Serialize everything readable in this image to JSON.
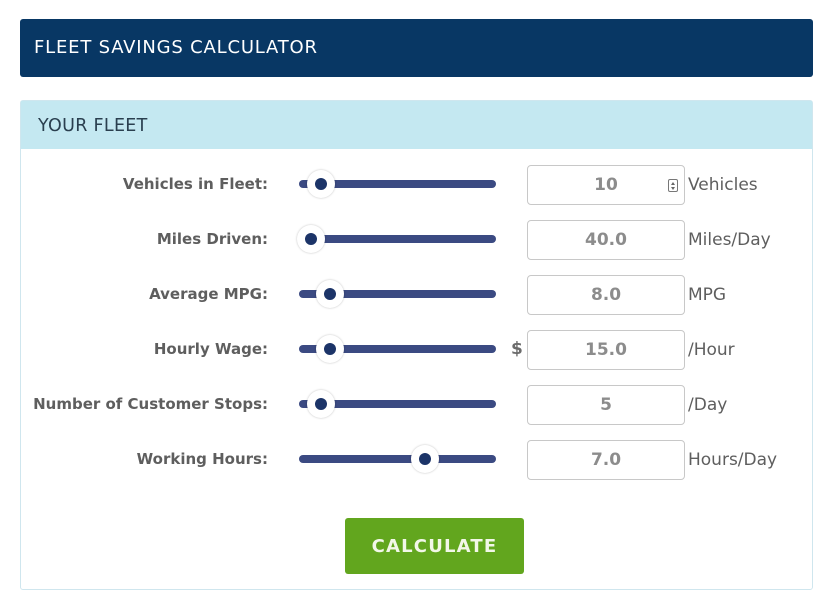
{
  "header": {
    "title": "FLEET SAVINGS CALCULATOR"
  },
  "panel": {
    "title": "YOUR FLEET"
  },
  "accent_colors": {
    "header_bg": "#083764",
    "panel_head_bg": "#c4e8f1",
    "slider_track": "#3b4a82",
    "button_bg": "#62a61e"
  },
  "rows": [
    {
      "label": "Vehicles in Fleet:",
      "value": "10",
      "unit": "Vehicles",
      "prefix": "",
      "slider_fraction": 0.06,
      "has_spinner": true
    },
    {
      "label": "Miles Driven:",
      "value": "40.0",
      "unit": "Miles/Day",
      "prefix": "",
      "slider_fraction": 0.0,
      "has_spinner": false
    },
    {
      "label": "Average MPG:",
      "value": "8.0",
      "unit": "MPG",
      "prefix": "",
      "slider_fraction": 0.11,
      "has_spinner": false
    },
    {
      "label": "Hourly Wage:",
      "value": "15.0",
      "unit": "/Hour",
      "prefix": "$",
      "slider_fraction": 0.11,
      "has_spinner": false
    },
    {
      "label": "Number of Customer Stops:",
      "value": "5",
      "unit": "/Day",
      "prefix": "",
      "slider_fraction": 0.06,
      "has_spinner": false
    },
    {
      "label": "Working Hours:",
      "value": "7.0",
      "unit": "Hours/Day",
      "prefix": "",
      "slider_fraction": 0.66,
      "has_spinner": false
    }
  ],
  "actions": {
    "calculate_label": "CALCULATE"
  }
}
